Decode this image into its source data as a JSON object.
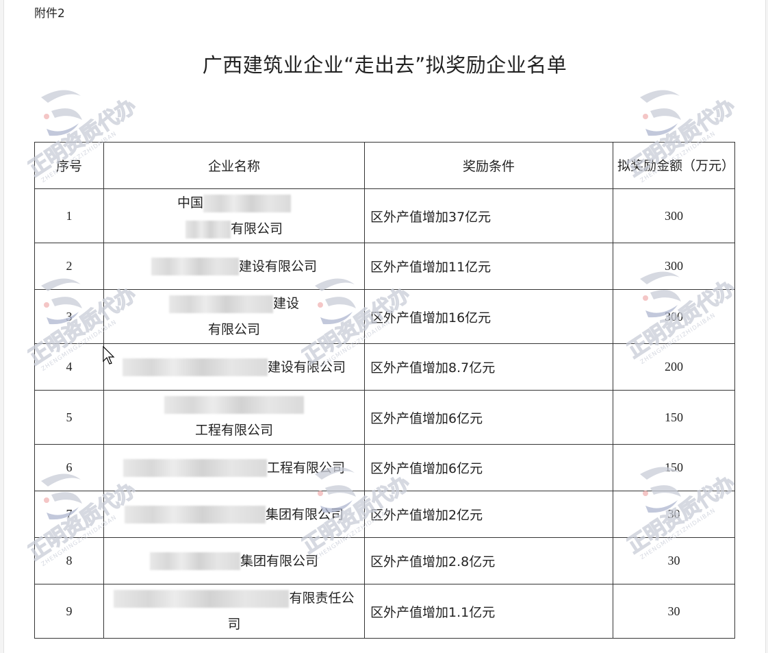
{
  "attachment_label": "附件2",
  "title": "广西建筑业企业“走出去”拟奖励企业名单",
  "table": {
    "headers": {
      "no": "序号",
      "name": "企业名称",
      "condition": "奖励条件",
      "amount": "拟奖励金额（万元）"
    },
    "rows": [
      {
        "no": "1",
        "name_lines": [
          {
            "blur_before": 0,
            "text": "中国",
            "blur_after": 128
          },
          {
            "blur_before": 66,
            "text": "有限公司",
            "blur_after": 0
          }
        ],
        "condition": "区外产值增加37亿元",
        "amount": "300"
      },
      {
        "no": "2",
        "name_lines": [
          {
            "blur_before": 128,
            "text": "建设有限公司",
            "blur_after": 0
          }
        ],
        "condition": "区外产值增加11亿元",
        "amount": "300"
      },
      {
        "no": "3",
        "name_lines": [
          {
            "blur_before": 152,
            "text": "建设",
            "blur_after": 0
          },
          {
            "blur_before": 0,
            "text": "有限公司",
            "blur_after": 0
          }
        ],
        "condition": "区外产值增加16亿元",
        "amount": "300"
      },
      {
        "no": "4",
        "name_lines": [
          {
            "blur_before": 212,
            "text": "建设有限公司",
            "blur_after": 0
          }
        ],
        "condition": "区外产值增加8.7亿元",
        "amount": "200"
      },
      {
        "no": "5",
        "name_lines": [
          {
            "blur_before": 0,
            "text": "",
            "blur_after": 204
          },
          {
            "blur_before": 0,
            "text": "工程有限公司",
            "blur_after": 0
          }
        ],
        "condition": "区外产值增加6亿元",
        "amount": "150"
      },
      {
        "no": "6",
        "name_lines": [
          {
            "blur_before": 210,
            "text": "工程有限公司",
            "blur_after": 0
          }
        ],
        "condition": "区外产值增加6亿元",
        "amount": "150"
      },
      {
        "no": "7",
        "name_lines": [
          {
            "blur_before": 206,
            "text": "集团有限公司",
            "blur_after": 0
          }
        ],
        "condition": "区外产值增加2亿元",
        "amount": "30"
      },
      {
        "no": "8",
        "name_lines": [
          {
            "blur_before": 132,
            "text": "集团有限公司",
            "blur_after": 0
          }
        ],
        "condition": "区外产值增加2.8亿元",
        "amount": "30"
      },
      {
        "no": "9",
        "name_lines": [
          {
            "blur_before": 256,
            "text": "有限责任公",
            "blur_after": 0
          },
          {
            "blur_before": 0,
            "text": "司",
            "blur_after": 0
          }
        ],
        "condition": "区外产值增加1.1亿元",
        "amount": "30"
      }
    ]
  },
  "watermark": {
    "text": "正明资质代办",
    "sub_text": "ZHENGMINGZIZHIDAIBAN"
  },
  "colors": {
    "watermark": "#c9cdd8",
    "watermark_accent": "#f1b3b3"
  }
}
